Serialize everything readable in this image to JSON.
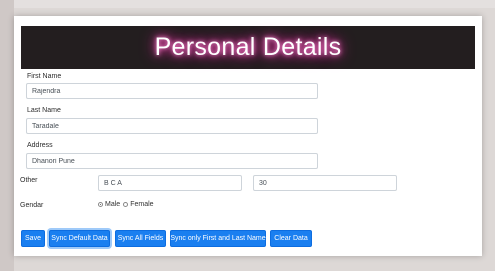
{
  "banner": {
    "title": "Personal Details"
  },
  "form": {
    "first_name": {
      "label": "First Name",
      "value": "Rajendra"
    },
    "last_name": {
      "label": "Last Name",
      "value": "Taradale"
    },
    "address": {
      "label": "Address",
      "value": "Dhanori Pune"
    },
    "other": {
      "label": "Other",
      "value1": "B C A",
      "value2": "30"
    },
    "gender": {
      "label": "Gendar",
      "options": [
        "Male",
        "Female"
      ],
      "selected": "Male"
    }
  },
  "buttons": {
    "save": "Save",
    "sync_default": "Sync Default Data",
    "sync_all": "Sync All Fields",
    "sync_first_last": "Sync only First and Last Name",
    "clear": "Clear Data"
  },
  "colors": {
    "button": "#1a7ff0",
    "banner_bg": "#231e1f",
    "glow": "#ff2aa8"
  }
}
